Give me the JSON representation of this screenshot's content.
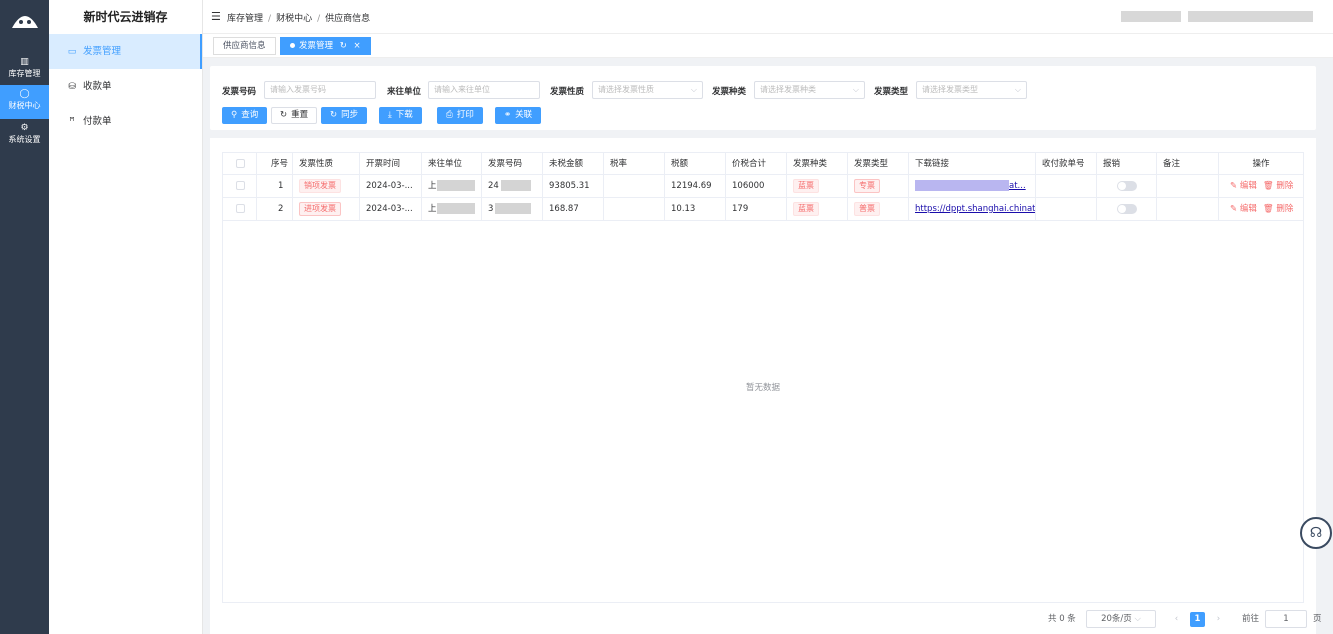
{
  "app": {
    "brand": "新时代云进销存"
  },
  "rail": {
    "items": [
      {
        "icon": "▥",
        "label": "库存管理"
      },
      {
        "icon": "◯",
        "label": "财税中心"
      },
      {
        "icon": "⚙",
        "label": "系统设置"
      }
    ]
  },
  "sidebar": {
    "items": [
      {
        "icon": "▭",
        "label": "发票管理"
      },
      {
        "icon": "⛁",
        "label": "收款单"
      },
      {
        "icon": "ꟸ",
        "label": "付款单"
      }
    ]
  },
  "header": {
    "breadcrumb": [
      "库存管理",
      "财税中心",
      "供应商信息"
    ]
  },
  "tabs": [
    {
      "label": "供应商信息"
    },
    {
      "label": "发票管理"
    }
  ],
  "filters": {
    "invoice_no_label": "发票号码",
    "invoice_no_placeholder": "请输入发票号码",
    "partner_label": "来往单位",
    "partner_placeholder": "请输入来往单位",
    "nature_label": "发票性质",
    "nature_placeholder": "请选择发票性质",
    "kind_label": "发票种类",
    "kind_placeholder": "请选择发票种类",
    "type_label": "发票类型",
    "type_placeholder": "请选择发票类型"
  },
  "toolbar": {
    "query": "查询",
    "reset": "重置",
    "sync": "同步",
    "download": "下载",
    "print": "打印",
    "link": "关联"
  },
  "table": {
    "columns": [
      "序号",
      "发票性质",
      "开票时间",
      "来往单位",
      "发票号码",
      "未税金额",
      "税率",
      "税额",
      "价税合计",
      "发票种类",
      "发票类型",
      "下载链接",
      "收付款单号",
      "报销",
      "备注",
      "操作"
    ],
    "rows": [
      {
        "index": "1",
        "nature": "销项发票",
        "date": "2024-03-...",
        "partner_prefix": "上",
        "invoice_prefix": "24",
        "net": "93805.31",
        "rate": "",
        "tax": "12194.69",
        "total": "106000",
        "kind": "蓝票",
        "type": "专票",
        "link": "at..."
      },
      {
        "index": "2",
        "nature": "进项发票",
        "date": "2024-03-...",
        "partner_prefix": "上",
        "invoice_prefix": "3",
        "net": "168.87",
        "rate": "",
        "tax": "10.13",
        "total": "179",
        "kind": "蓝票",
        "type": "普票",
        "link": "https://dppt.shanghai.chinat..."
      }
    ],
    "edit_label": "编辑",
    "delete_label": "删除",
    "empty_text": "暂无数据"
  },
  "pagination": {
    "total": "共 0 条",
    "page_size": "20条/页",
    "current": "1",
    "goto_label": "前往",
    "goto_value": "1",
    "page_suffix": "页"
  }
}
